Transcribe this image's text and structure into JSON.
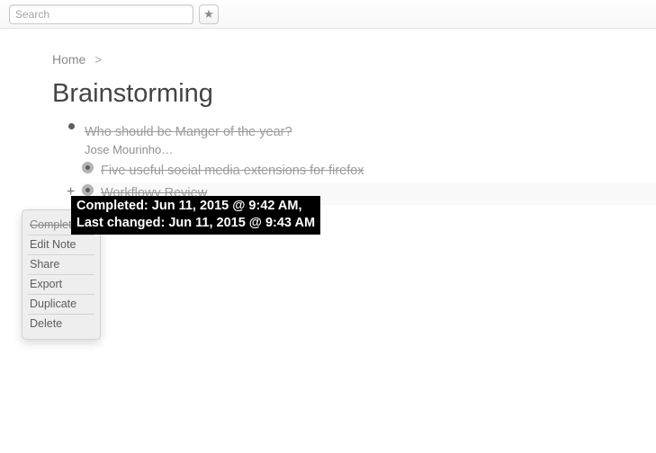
{
  "toolbar": {
    "search_placeholder": "Search",
    "star_symbol": "★"
  },
  "breadcrumb": {
    "home_label": "Home",
    "separator": ">"
  },
  "page": {
    "title": "Brainstorming"
  },
  "items": [
    {
      "text": "Who should be Manger of the year?",
      "done": true,
      "indent": 0,
      "bullet": "dot",
      "note": "Jose Mourinho…"
    },
    {
      "text": "Five useful social media extensions  for firefox",
      "done": true,
      "indent": 1,
      "bullet": "open"
    },
    {
      "text": "Workflowy Review",
      "done": true,
      "indent": 1,
      "bullet": "open",
      "active": true
    }
  ],
  "add_symbol": "+",
  "tooltip": {
    "line1": "Completed: Jun 11, 2015 @ 9:42 AM,",
    "line2": "Last changed: Jun 11, 2015 @ 9:43 AM"
  },
  "context_menu": {
    "complete": "Complete",
    "edit_note": "Edit Note",
    "share": "Share",
    "export": "Export",
    "duplicate": "Duplicate",
    "delete": "Delete"
  }
}
